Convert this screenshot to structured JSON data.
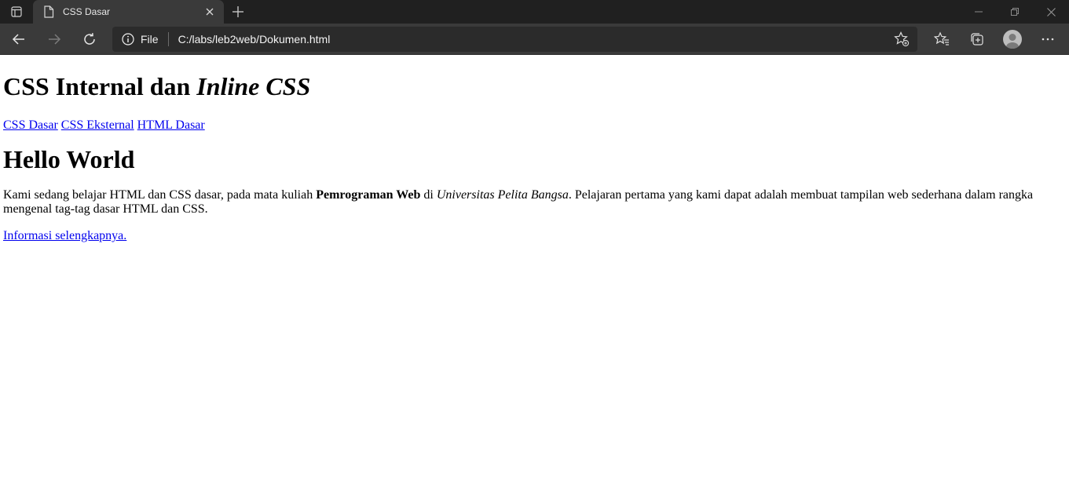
{
  "browser": {
    "tab": {
      "title": "CSS Dasar"
    },
    "address_bar": {
      "site_info_label": "File",
      "url": "C:/labs/leb2web/Dokumen.html"
    }
  },
  "page": {
    "heading_main": "CSS Internal dan ",
    "heading_main_italic": "Inline CSS",
    "nav_links": [
      "CSS Dasar",
      "CSS Eksternal",
      "HTML Dasar"
    ],
    "heading_secondary": "Hello World",
    "paragraph": {
      "part1": "Kami sedang belajar HTML dan CSS dasar, pada mata kuliah ",
      "bold": "Pemrograman Web",
      "part2": " di ",
      "italic": "Universitas Pelita Bangsa",
      "part3": ". Pelajaran pertama yang kami dapat adalah membuat tampilan web sederhana dalam rangka mengenal tag-tag dasar HTML dan CSS."
    },
    "more_link": "Informasi selengkapnya."
  },
  "colors": {
    "tabstrip_bg": "#202020",
    "toolbar_bg": "#3a3a3a",
    "addressbar_bg": "#2b2b2b",
    "link": "#0000ee"
  }
}
